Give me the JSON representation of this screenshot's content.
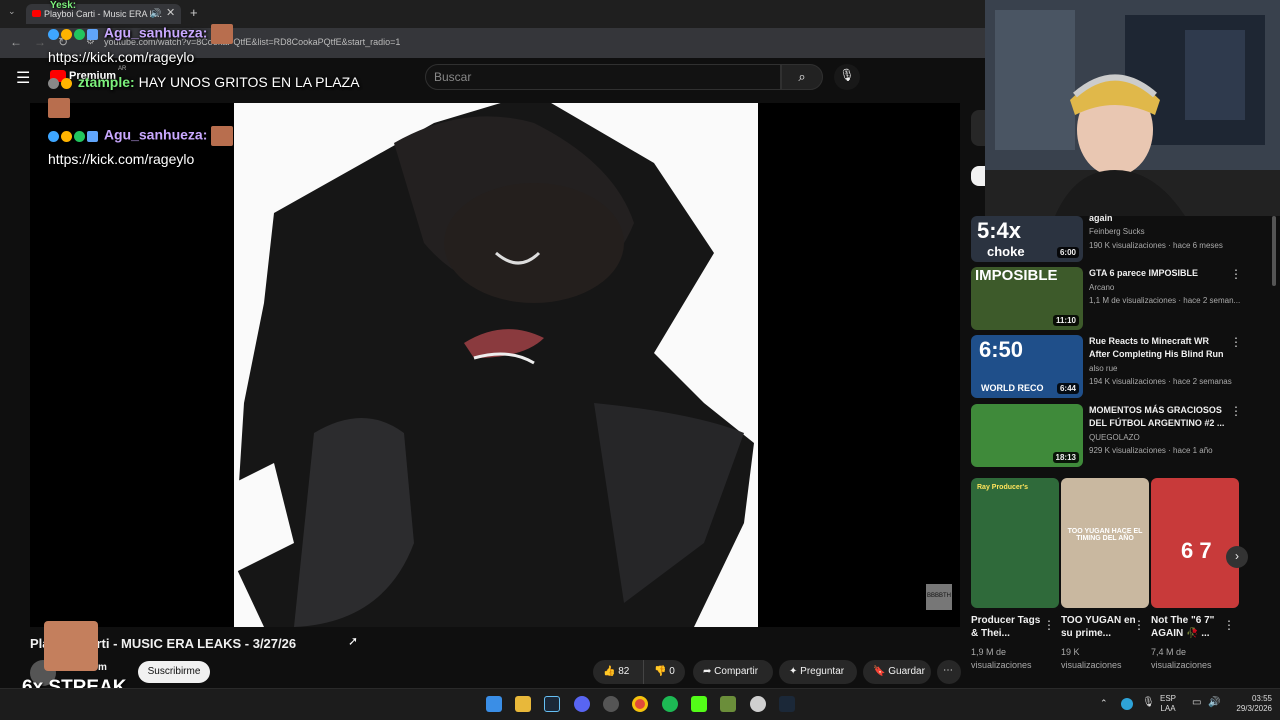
{
  "browser": {
    "tab_title": "Playboi Carti - Music ERA L...",
    "url": "youtube.com/watch?v=8CookaPQtfE&list=RD8CookaPQtfE&start_radio=1",
    "new_tab": "+"
  },
  "youtube": {
    "premium_label": "Premium",
    "premium_region": "AR",
    "search_placeholder": "Buscar"
  },
  "chat": {
    "line1_user": "Agu_sanhueza:",
    "line1_text": "https://kick.com/rageylo",
    "line2_user": "ztample:",
    "line2_text": "HAY UNOS GRITOS EN LA PLAZA",
    "line3_user": "Agu_sanhueza:",
    "line3_text": "https://kick.com/rageylo",
    "top_partial": "Yesk:"
  },
  "player": {
    "watermark": "BBBBTH"
  },
  "video": {
    "title": "Playboi Carti - MUSIC ERA LEAKS - 3/27/26",
    "channel": "m",
    "subscribe_label": "Suscribirme",
    "likes": "82",
    "dislikes": "0",
    "share_label": "Compartir",
    "ask_label": "Preguntar",
    "save_label": "Guardar",
    "more_label": "⋯"
  },
  "overlay": {
    "streak": "6x STREAK"
  },
  "sidebar": {
    "partial_top": {
      "title": "again",
      "channel": "Feinberg Sucks",
      "meta": "190 K visualizaciones · hace 6 meses",
      "duration": "6:00",
      "thumb_text": "5:4x choke"
    },
    "videos": [
      {
        "title": "GTA 6 parece IMPOSIBLE",
        "channel": "Arcano",
        "meta": "1,1 M de visualizaciones · hace 2 seman...",
        "duration": "11:10",
        "thumb_text": "IMPOSIBLE",
        "thumb_color": "#3d5a2a"
      },
      {
        "title": "Rue Reacts to Minecraft WR After Completing His Blind Run",
        "channel": "also rue",
        "meta": "194 K visualizaciones · hace 2 semanas",
        "duration": "6:44",
        "thumb_text": "6:50 WORLD RECO",
        "thumb_color": "#1f4f8a"
      },
      {
        "title": "MOMENTOS MÁS GRACIOSOS DEL FÚTBOL ARGENTINO #2 ...",
        "channel": "QUEGOLAZO",
        "meta": "929 K visualizaciones · hace 1 año",
        "duration": "18:13",
        "thumb_text": "",
        "thumb_color": "#3f8a3a"
      }
    ],
    "shorts": [
      {
        "title": "Producer Tags & Thei...",
        "views": "1,9 M de",
        "views2": "visualizaciones",
        "thumb_color": "#2f6a3a",
        "thumb_text": "Ray Producer's"
      },
      {
        "title": "TOO YUGAN en su prime...",
        "views": "19 K",
        "views2": "visualizaciones",
        "thumb_color": "#c9b8a0",
        "thumb_text": "TOO YUGAN HACE EL TIMING DEL AÑO"
      },
      {
        "title": "Not The \"6 7\" AGAIN 🥀 ...",
        "views": "7,4 M de",
        "views2": "visualizaciones",
        "thumb_color": "#c83a3a",
        "thumb_text": "6 7"
      }
    ]
  },
  "taskbar": {
    "lang_top": "ESP",
    "lang_bottom": "LAA",
    "time": "03:55",
    "date": "29/3/2026"
  }
}
